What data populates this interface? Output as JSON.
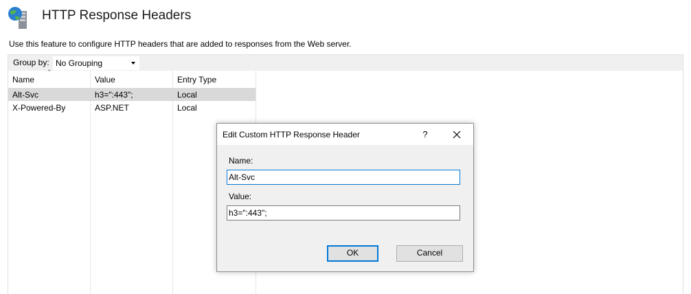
{
  "page": {
    "title": "HTTP Response Headers",
    "description": "Use this feature to configure HTTP headers that are added to responses from the Web server.",
    "icon": "http-headers-icon"
  },
  "toolbar": {
    "group_by_label": "Group by:",
    "group_by_value": "No Grouping"
  },
  "grid": {
    "columns": [
      "Name",
      "Value",
      "Entry Type"
    ],
    "rows": [
      {
        "name": "Alt-Svc",
        "value": "h3=\":443\";",
        "entry_type": "Local",
        "selected": true
      },
      {
        "name": "X-Powered-By",
        "value": "ASP.NET",
        "entry_type": "Local",
        "selected": false
      }
    ]
  },
  "dialog": {
    "title": "Edit Custom HTTP Response Header",
    "help_label": "?",
    "name_label": "Name:",
    "name_value": "Alt-Svc",
    "value_label": "Value:",
    "value_value": "h3=\":443\";",
    "ok_label": "OK",
    "cancel_label": "Cancel"
  },
  "colors": {
    "selected_row": "#d9d9d9",
    "dialog_body": "#f0f0f0",
    "focus_border": "#0078d7"
  }
}
